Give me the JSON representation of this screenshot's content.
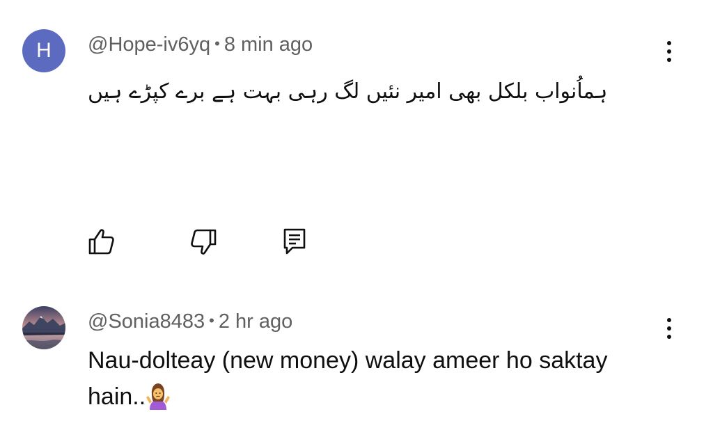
{
  "comments": [
    {
      "avatar_letter": "H",
      "avatar_color": "#5c6bc0",
      "author": "@Hope-iv6yq",
      "separator": "•",
      "time": "8 min ago",
      "text": "ہماُنواب بلکل بھی امیر نئیں لگ رہی بہت ہے برے کپڑے ہیں",
      "actions": [
        "like-icon",
        "dislike-icon",
        "reply-icon"
      ]
    },
    {
      "avatar_image": "landscape-photo-avatar",
      "author": "@Sonia8483",
      "separator": "•",
      "time": "2 hr ago",
      "text": "Nau-dolteay (new money) walay ameer ho saktay hain..",
      "emoji": "person-shrugging-emoji"
    }
  ],
  "colors": {
    "meta_text": "#606060",
    "body_text": "#0f0f0f",
    "background": "#ffffff"
  }
}
